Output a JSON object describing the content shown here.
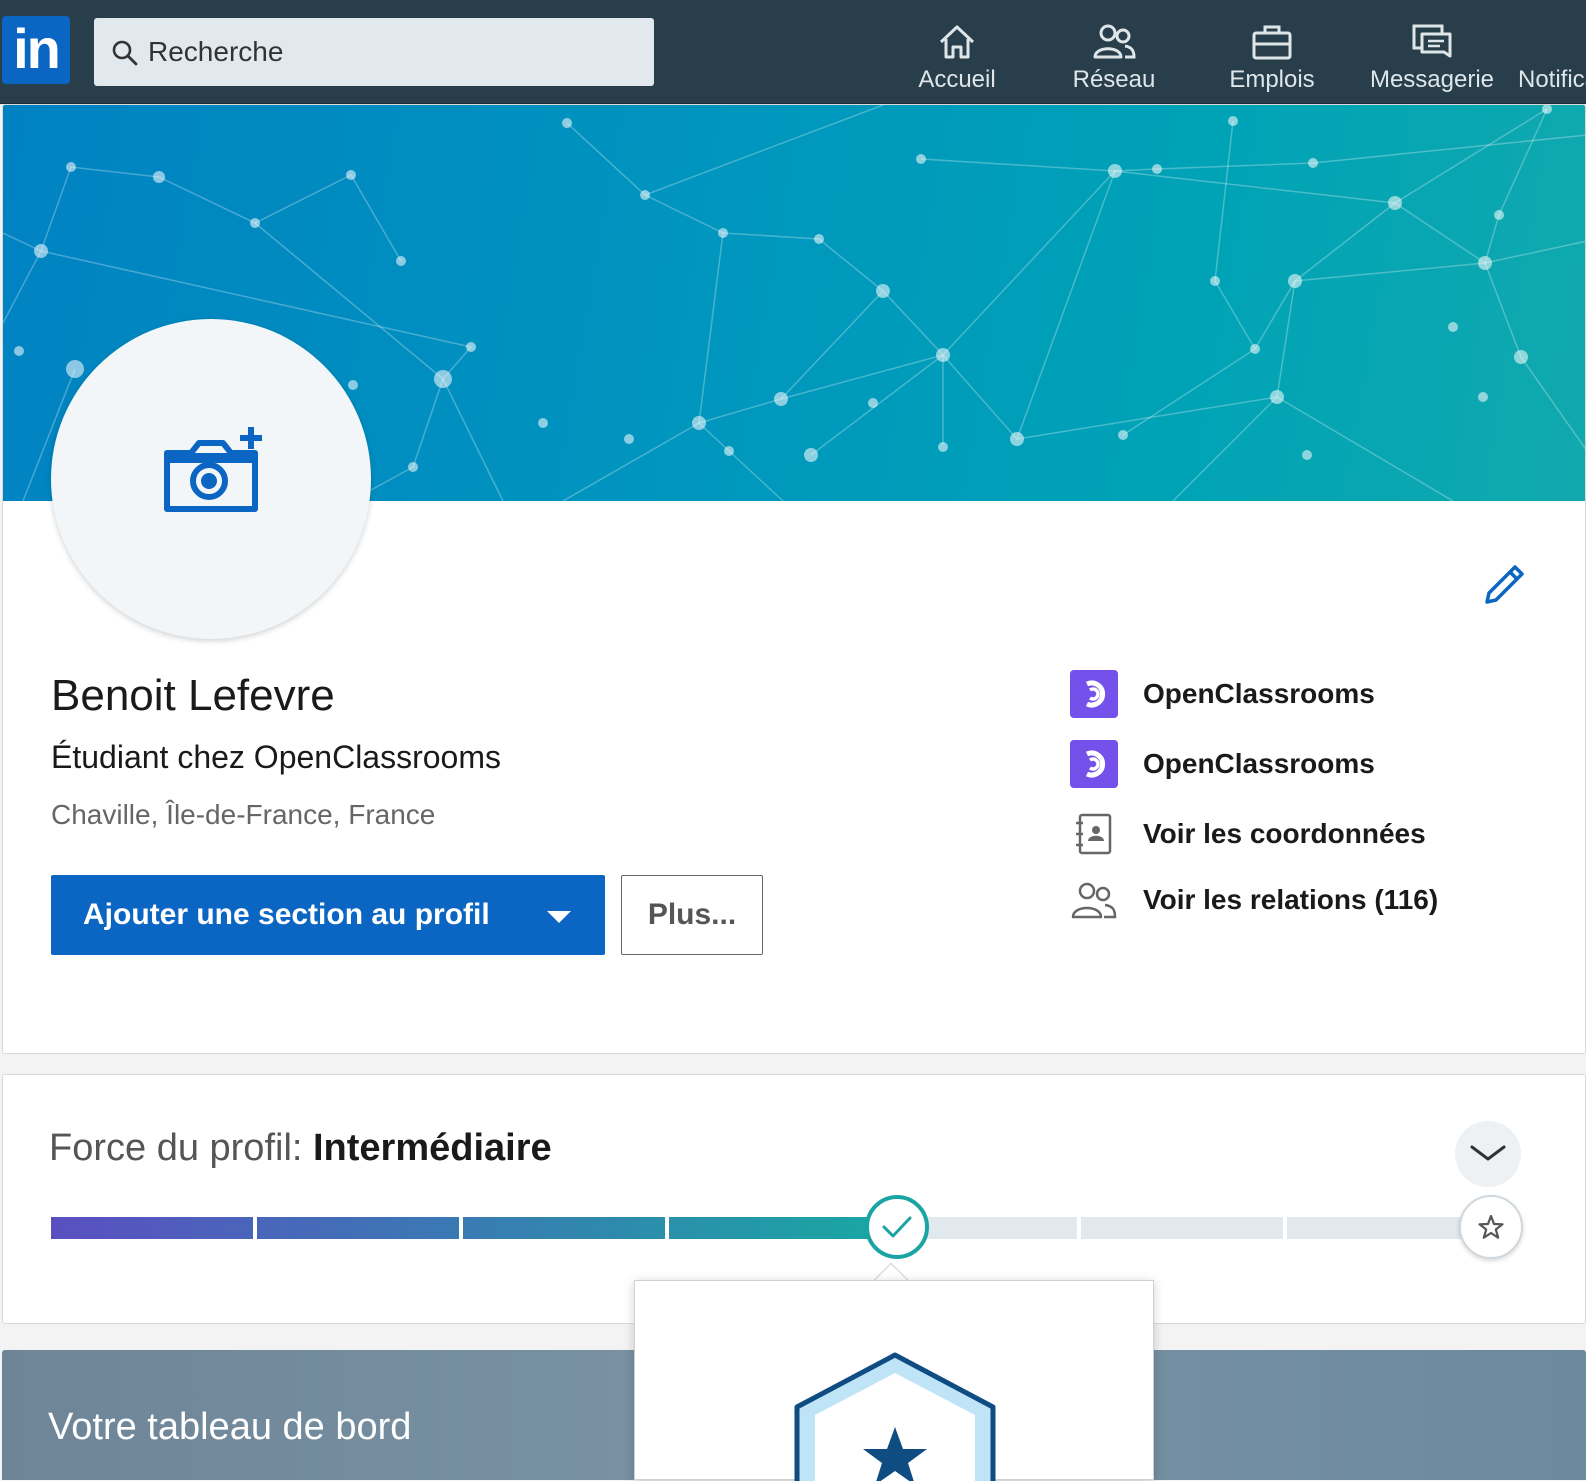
{
  "nav": {
    "logo_text": "in",
    "search_placeholder": "Recherche",
    "items": [
      {
        "label": "Accueil",
        "icon": "home-icon"
      },
      {
        "label": "Réseau",
        "icon": "network-icon"
      },
      {
        "label": "Emplois",
        "icon": "briefcase-icon"
      },
      {
        "label": "Messagerie",
        "icon": "messaging-icon"
      },
      {
        "label": "Notifications",
        "icon": "bell-icon"
      }
    ]
  },
  "profile": {
    "name": "Benoit Lefevre",
    "headline": "Étudiant chez OpenClassrooms",
    "location": "Chaville, Île-de-France, France",
    "add_section_button": "Ajouter une section au profil",
    "more_button": "Plus...",
    "side_links": [
      {
        "label": "OpenClassrooms",
        "icon": "openclassrooms-logo"
      },
      {
        "label": "OpenClassrooms",
        "icon": "openclassrooms-logo"
      },
      {
        "label": "Voir les coordonnées",
        "icon": "contact-card-icon"
      },
      {
        "label": "Voir les relations (116)",
        "icon": "connections-icon"
      }
    ]
  },
  "strength": {
    "title_prefix": "Force du profil: ",
    "level": "Intermédiaire",
    "completed_segments": 4,
    "total_segments": 7
  },
  "dashboard": {
    "title": "Votre tableau de bord"
  },
  "colors": {
    "brand": "#0a66c2",
    "nav_bg": "#283e4a",
    "openclassrooms": "#7451eb",
    "meter_start": "#5a4fc1",
    "meter_end": "#1aa5a4",
    "meter_empty": "#e1e9ee"
  }
}
